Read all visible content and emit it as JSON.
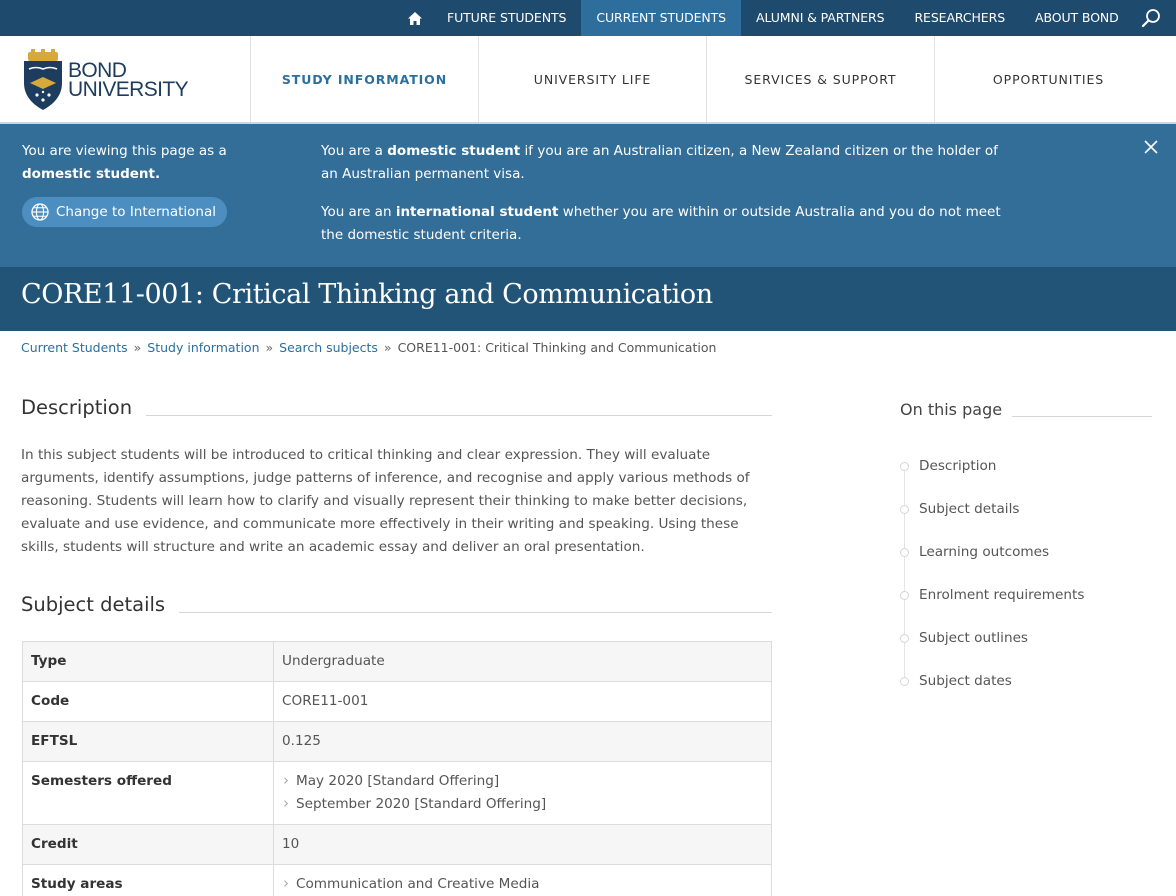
{
  "topnav": {
    "links": [
      "FUTURE STUDENTS",
      "CURRENT STUDENTS",
      "ALUMNI & PARTNERS",
      "RESEARCHERS",
      "ABOUT BOND"
    ],
    "active_index": 1
  },
  "logo": {
    "line1": "BOND",
    "line2": "UNIVERSITY"
  },
  "mainnav": {
    "items": [
      "STUDY INFORMATION",
      "UNIVERSITY LIFE",
      "SERVICES & SUPPORT",
      "OPPORTUNITIES"
    ],
    "active_index": 0
  },
  "notice": {
    "viewing_prefix": "You are viewing this page as a",
    "viewing_status": "domestic student.",
    "change_button": "Change to International",
    "domestic_prefix": "You are a",
    "domestic_bold": "domestic student",
    "domestic_rest": "if you are an Australian citizen, a New Zealand citizen or the holder of an Australian permanent visa.",
    "international_prefix": "You are an",
    "international_bold": "international student",
    "international_rest": "whether you are within or outside Australia and you do not meet the domestic student criteria."
  },
  "page_title": "CORE11-001: Critical Thinking and Communication",
  "breadcrumb": {
    "items": [
      "Current Students",
      "Study information",
      "Search subjects"
    ],
    "current": "CORE11-001: Critical Thinking and Communication",
    "separator": "»"
  },
  "description": {
    "heading": "Description",
    "text": "In this subject students will be introduced to critical thinking and clear expression. They will evaluate arguments, identify assumptions, judge patterns of inference, and recognise and apply various methods of reasoning. Students will learn how to clarify and visually represent their thinking to make better decisions, evaluate and use evidence, and communicate more effectively in their writing and speaking. Using these skills, students will structure and write an academic essay and deliver an oral presentation."
  },
  "subject_details": {
    "heading": "Subject details",
    "rows": [
      {
        "label": "Type",
        "value": "Undergraduate"
      },
      {
        "label": "Code",
        "value": "CORE11-001"
      },
      {
        "label": "EFTSL",
        "value": "0.125"
      },
      {
        "label": "Semesters offered",
        "list": [
          "May 2020 [Standard Offering]",
          "September 2020 [Standard Offering]"
        ]
      },
      {
        "label": "Credit",
        "value": "10"
      },
      {
        "label": "Study areas",
        "list": [
          "Communication and Creative Media"
        ]
      }
    ]
  },
  "on_this_page": {
    "heading": "On this page",
    "items": [
      "Description",
      "Subject details",
      "Learning outcomes",
      "Enrolment requirements",
      "Subject outlines",
      "Subject dates"
    ]
  },
  "colors": {
    "topbar": "#1e4a6e",
    "topbar_active": "#2d6e9c",
    "notice_bg": "#336e99",
    "title_bg": "#215476",
    "link": "#2a6f9e"
  }
}
